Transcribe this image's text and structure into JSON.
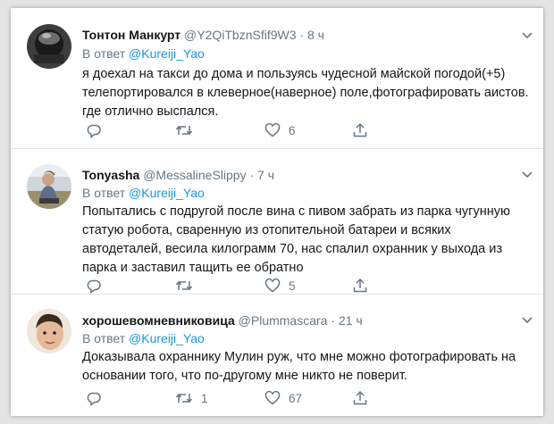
{
  "reply_prefix": "В ответ",
  "tweets": [
    {
      "name": "Тонтон Манкурт",
      "handle": "@Y2QiTbznSfif9W3",
      "separator": "·",
      "time": "8 ч",
      "reply_to": "@Kureiji_Yao",
      "lines": [
        "я доехал на такси до дома и пользуясь чудесной майской погодой(+5)",
        "телепортировался в клеверное(наверное) поле,фотографировать аистов.",
        "где отлично выспался."
      ],
      "replies": "",
      "retweets": "",
      "likes": "6"
    },
    {
      "name": "Tonyasha",
      "handle": "@MessalineSlippy",
      "separator": "·",
      "time": "7 ч",
      "reply_to": "@Kureiji_Yao",
      "lines": [
        "Попытались с подругой после вина с пивом забрать из парка чугунную",
        "статую робота, сваренную из отопительной батареи и всяких",
        "автодеталей, весила килограмм 70, нас спалил охранник у выхода из",
        "парка и заставил тащить ее обратно"
      ],
      "replies": "",
      "retweets": "",
      "likes": "5"
    },
    {
      "name": "хорошевомневниковица",
      "handle": "@Plummascara",
      "separator": "·",
      "time": "21 ч",
      "reply_to": "@Kureiji_Yao",
      "lines": [
        "Доказывала охраннику Мулин руж, что мне можно фотографировать на",
        "основании того, что по-другому мне никто не поверит."
      ],
      "replies": "",
      "retweets": "1",
      "likes": "67"
    }
  ],
  "icons": {
    "reply": "reply-icon",
    "retweet": "retweet-icon",
    "like": "heart-icon",
    "share": "share-icon",
    "more": "chevron-down-icon"
  },
  "colors": {
    "link": "#1b95e0",
    "muted": "#657786",
    "text": "#14171a",
    "divider": "#dfe4e8"
  }
}
